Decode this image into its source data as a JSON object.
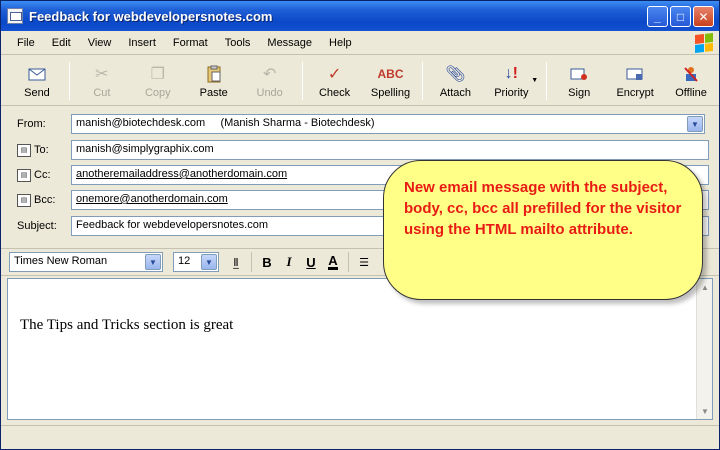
{
  "window": {
    "title": "Feedback for webdevelopersnotes.com"
  },
  "menu": [
    "File",
    "Edit",
    "View",
    "Insert",
    "Format",
    "Tools",
    "Message",
    "Help"
  ],
  "toolbar": {
    "send": "Send",
    "cut": "Cut",
    "copy": "Copy",
    "paste": "Paste",
    "undo": "Undo",
    "check": "Check",
    "spelling": "Spelling",
    "attach": "Attach",
    "priority": "Priority",
    "sign": "Sign",
    "encrypt": "Encrypt",
    "offline": "Offline"
  },
  "headers": {
    "from_label": "From:",
    "from_value": "manish@biotechdesk.com     (Manish Sharma - Biotechdesk)",
    "to_label": "To:",
    "to_value": "manish@simplygraphix.com",
    "cc_label": "Cc:",
    "cc_value": "anotheremailaddress@anotherdomain.com",
    "bcc_label": "Bcc:",
    "bcc_value": "onemore@anotherdomain.com",
    "subject_label": "Subject:",
    "subject_value": "Feedback for webdevelopersnotes.com"
  },
  "format": {
    "font": "Times New Roman",
    "size": "12"
  },
  "body": {
    "text": "The Tips and Tricks section is great"
  },
  "callout": {
    "text": "New email message with the subject, body, cc, bcc all prefilled for the visitor using the HTML mailto attribute."
  },
  "colors": {
    "titlebar": "#0a48c8",
    "callout_bg": "#ffff88",
    "callout_text": "#e81c14"
  }
}
